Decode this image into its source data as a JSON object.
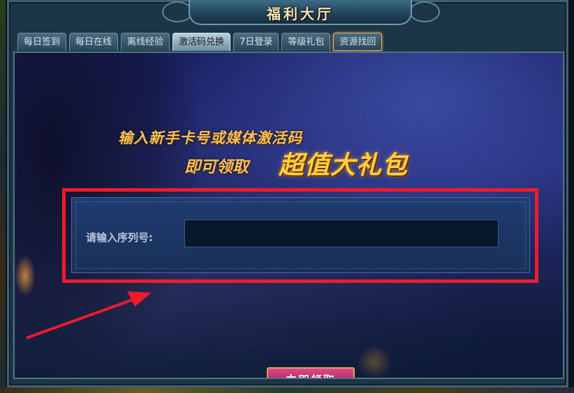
{
  "window": {
    "title": "福利大厅"
  },
  "tabs": [
    {
      "label": "每日签到",
      "active": false
    },
    {
      "label": "每日在线",
      "active": false
    },
    {
      "label": "离线经验",
      "active": false
    },
    {
      "label": "激活码兑换",
      "active": true
    },
    {
      "label": "7日登录",
      "active": false
    },
    {
      "label": "等级礼包",
      "active": false
    },
    {
      "label": "资源找回",
      "active": false
    }
  ],
  "promo": {
    "line1": "输入新手卡号或媒体激活码",
    "line2": "即可领取",
    "highlight": "超值大礼包"
  },
  "serial": {
    "label": "请输入序列号:",
    "value": "",
    "placeholder": ""
  },
  "claim_button": {
    "label": "立即领取"
  },
  "annotation": {
    "outline_color": "#ec1c2a",
    "arrow_color": "#ec1c2a"
  },
  "colors": {
    "title_text": "#f4e4b8",
    "promo_text": "#f0c060",
    "button_bg": "#b0235f"
  }
}
